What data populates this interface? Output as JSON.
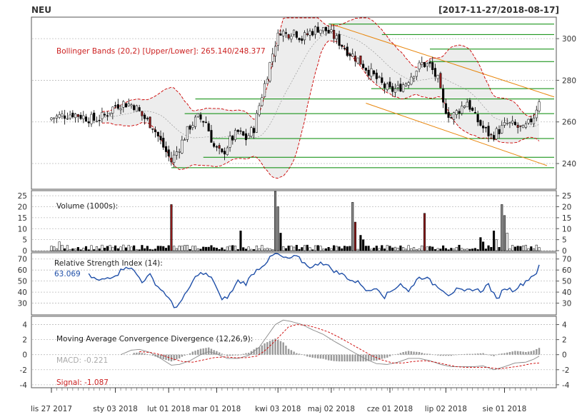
{
  "header": {
    "symbol": "NEU",
    "date_range": "[2017-11-27/2018-08-17]"
  },
  "colors": {
    "up_candle": "#ffffff",
    "down_candle": "#8b1a1a",
    "candle_border": "#000000",
    "bollinger_line": "#cc0000",
    "bollinger_fill": "#ededed",
    "hline": "#008800",
    "trend_channel": "#e8860c",
    "rsi_line": "#1f4fa8",
    "macd_bar": "#999999",
    "grid": "#bbbbbb"
  },
  "chart_data": {
    "type": "candlestick",
    "symbol": "NEU",
    "x_tick_labels": [
      "lis 27 2017",
      "sty 03 2018",
      "lut 01 2018",
      "mar 01 2018",
      "kwi 03 2018",
      "maj 02 2018",
      "cze 01 2018",
      "lip 02 2018",
      "sie 01 2018"
    ],
    "x_tick_index": [
      0,
      24,
      44,
      62,
      85,
      105,
      127,
      148,
      170
    ],
    "n_bars": 184,
    "price": {
      "ylim": [
        228,
        310
      ],
      "y_ticks": [
        240,
        260,
        280,
        300
      ],
      "bollinger_label": "Bollinger Bands (20,2) [Upper/Lower]: 265.140/248.377",
      "horizontal_levels": [
        307,
        302,
        295,
        289,
        276,
        271,
        264,
        252,
        243,
        238
      ],
      "trend_channel": {
        "upper": [
          [
            105,
            307
          ],
          [
            183,
            272
          ]
        ],
        "lower": [
          [
            118,
            269
          ],
          [
            183,
            239
          ]
        ]
      },
      "close_anchors": [
        [
          0,
          262
        ],
        [
          8,
          264
        ],
        [
          16,
          261
        ],
        [
          20,
          263
        ],
        [
          24,
          268
        ],
        [
          27,
          269
        ],
        [
          31,
          268
        ],
        [
          34,
          263
        ],
        [
          38,
          258
        ],
        [
          42,
          248
        ],
        [
          45,
          241
        ],
        [
          48,
          248
        ],
        [
          52,
          258
        ],
        [
          55,
          262
        ],
        [
          58,
          260
        ],
        [
          61,
          248
        ],
        [
          64,
          244
        ],
        [
          67,
          251
        ],
        [
          70,
          255
        ],
        [
          73,
          252
        ],
        [
          76,
          257
        ],
        [
          78,
          268
        ],
        [
          80,
          278
        ],
        [
          82,
          288
        ],
        [
          84,
          298
        ],
        [
          86,
          304
        ],
        [
          88,
          302
        ],
        [
          91,
          304
        ],
        [
          94,
          300
        ],
        [
          97,
          303
        ],
        [
          100,
          305
        ],
        [
          103,
          304
        ],
        [
          106,
          301
        ],
        [
          109,
          297
        ],
        [
          112,
          293
        ],
        [
          115,
          290
        ],
        [
          118,
          286
        ],
        [
          121,
          282
        ],
        [
          124,
          278
        ],
        [
          127,
          275
        ],
        [
          130,
          276
        ],
        [
          133,
          279
        ],
        [
          136,
          284
        ],
        [
          139,
          288
        ],
        [
          142,
          287
        ],
        [
          145,
          280
        ],
        [
          147,
          268
        ],
        [
          150,
          262
        ],
        [
          153,
          266
        ],
        [
          156,
          270
        ],
        [
          159,
          262
        ],
        [
          162,
          257
        ],
        [
          165,
          253
        ],
        [
          168,
          256
        ],
        [
          171,
          259
        ],
        [
          174,
          258
        ],
        [
          177,
          256
        ],
        [
          179,
          259
        ],
        [
          181,
          263
        ],
        [
          183,
          271
        ]
      ]
    },
    "volume": {
      "label": "Volume (1000s):",
      "ylim": [
        0,
        27
      ],
      "y_ticks": [
        0,
        5,
        10,
        15,
        20,
        25
      ],
      "spikes": [
        [
          3,
          4
        ],
        [
          45,
          21
        ],
        [
          71,
          9
        ],
        [
          84,
          27
        ],
        [
          85,
          20
        ],
        [
          86,
          8
        ],
        [
          113,
          22
        ],
        [
          114,
          13
        ],
        [
          116,
          7
        ],
        [
          117,
          5
        ],
        [
          140,
          17
        ],
        [
          161,
          6
        ],
        [
          162,
          4
        ],
        [
          166,
          9
        ],
        [
          167,
          5
        ],
        [
          169,
          21
        ],
        [
          170,
          16
        ],
        [
          171,
          8
        ]
      ]
    },
    "rsi": {
      "label": "Relative Strength Index (14):",
      "value_label": "63.069",
      "value": 63.069,
      "ylim": [
        20,
        75
      ],
      "y_ticks": [
        30,
        40,
        50,
        60,
        70
      ],
      "anchors": [
        [
          14,
          55
        ],
        [
          18,
          50
        ],
        [
          22,
          54
        ],
        [
          25,
          57
        ],
        [
          28,
          64
        ],
        [
          31,
          59
        ],
        [
          34,
          50
        ],
        [
          37,
          55
        ],
        [
          40,
          45
        ],
        [
          43,
          38
        ],
        [
          46,
          26
        ],
        [
          49,
          32
        ],
        [
          52,
          45
        ],
        [
          55,
          57
        ],
        [
          58,
          56
        ],
        [
          61,
          50
        ],
        [
          64,
          32
        ],
        [
          67,
          38
        ],
        [
          70,
          50
        ],
        [
          73,
          48
        ],
        [
          76,
          58
        ],
        [
          80,
          66
        ],
        [
          84,
          75
        ],
        [
          88,
          70
        ],
        [
          92,
          72
        ],
        [
          95,
          66
        ],
        [
          98,
          62
        ],
        [
          101,
          68
        ],
        [
          104,
          63
        ],
        [
          107,
          58
        ],
        [
          110,
          55
        ],
        [
          113,
          50
        ],
        [
          116,
          48
        ],
        [
          119,
          40
        ],
        [
          122,
          45
        ],
        [
          125,
          36
        ],
        [
          128,
          42
        ],
        [
          131,
          48
        ],
        [
          134,
          40
        ],
        [
          137,
          52
        ],
        [
          140,
          54
        ],
        [
          143,
          48
        ],
        [
          146,
          44
        ],
        [
          149,
          38
        ],
        [
          152,
          42
        ],
        [
          155,
          40
        ],
        [
          158,
          43
        ],
        [
          161,
          41
        ],
        [
          164,
          47
        ],
        [
          167,
          33
        ],
        [
          170,
          44
        ],
        [
          173,
          42
        ],
        [
          176,
          46
        ],
        [
          179,
          52
        ],
        [
          182,
          58
        ],
        [
          183,
          63
        ]
      ]
    },
    "macd": {
      "label": "Moving Average Convergence Divergence (12,26,9):",
      "macd_label": "MACD: -0.221",
      "signal_label": "Signal: -1.087",
      "macd_value": -0.221,
      "signal_value": -1.087,
      "ylim": [
        -4.3,
        5
      ],
      "y_ticks": [
        -4,
        -2,
        0,
        2,
        4
      ],
      "macd_anchors": [
        [
          26,
          0
        ],
        [
          30,
          0.6
        ],
        [
          33,
          0.7
        ],
        [
          37,
          0.3
        ],
        [
          41,
          -0.5
        ],
        [
          45,
          -1.4
        ],
        [
          48,
          -1.3
        ],
        [
          52,
          -0.8
        ],
        [
          56,
          0
        ],
        [
          59,
          0.4
        ],
        [
          62,
          0.1
        ],
        [
          66,
          -0.5
        ],
        [
          70,
          -0.5
        ],
        [
          74,
          -0.1
        ],
        [
          78,
          1.0
        ],
        [
          81,
          2.5
        ],
        [
          84,
          4.0
        ],
        [
          87,
          4.6
        ],
        [
          90,
          4.4
        ],
        [
          94,
          4.0
        ],
        [
          98,
          3.3
        ],
        [
          102,
          2.7
        ],
        [
          106,
          1.8
        ],
        [
          110,
          1.0
        ],
        [
          114,
          0.2
        ],
        [
          118,
          -0.6
        ],
        [
          122,
          -1.2
        ],
        [
          126,
          -1.3
        ],
        [
          130,
          -1.0
        ],
        [
          134,
          -0.5
        ],
        [
          138,
          -0.5
        ],
        [
          142,
          -0.8
        ],
        [
          146,
          -1.3
        ],
        [
          150,
          -1.6
        ],
        [
          154,
          -1.6
        ],
        [
          158,
          -1.6
        ],
        [
          162,
          -1.5
        ],
        [
          166,
          -2.0
        ],
        [
          170,
          -1.6
        ],
        [
          174,
          -1.1
        ],
        [
          178,
          -1.0
        ],
        [
          181,
          -0.6
        ],
        [
          183,
          -0.2
        ]
      ],
      "signal_anchors": [
        [
          33,
          0.4
        ],
        [
          37,
          0.3
        ],
        [
          41,
          0.0
        ],
        [
          45,
          -0.5
        ],
        [
          49,
          -0.9
        ],
        [
          53,
          -1.0
        ],
        [
          57,
          -0.7
        ],
        [
          61,
          -0.4
        ],
        [
          65,
          -0.3
        ],
        [
          69,
          -0.4
        ],
        [
          73,
          -0.4
        ],
        [
          77,
          -0.2
        ],
        [
          80,
          0.5
        ],
        [
          83,
          1.5
        ],
        [
          86,
          2.6
        ],
        [
          89,
          3.7
        ],
        [
          92,
          4.0
        ],
        [
          96,
          3.9
        ],
        [
          100,
          3.5
        ],
        [
          104,
          3.0
        ],
        [
          108,
          2.3
        ],
        [
          112,
          1.5
        ],
        [
          116,
          0.7
        ],
        [
          120,
          -0.1
        ],
        [
          124,
          -0.7
        ],
        [
          128,
          -1.1
        ],
        [
          132,
          -1.1
        ],
        [
          136,
          -0.9
        ],
        [
          140,
          -0.8
        ],
        [
          144,
          -1.0
        ],
        [
          148,
          -1.3
        ],
        [
          152,
          -1.6
        ],
        [
          156,
          -1.7
        ],
        [
          160,
          -1.7
        ],
        [
          164,
          -1.7
        ],
        [
          168,
          -1.9
        ],
        [
          172,
          -1.7
        ],
        [
          176,
          -1.5
        ],
        [
          180,
          -1.2
        ],
        [
          183,
          -1.1
        ]
      ]
    }
  }
}
